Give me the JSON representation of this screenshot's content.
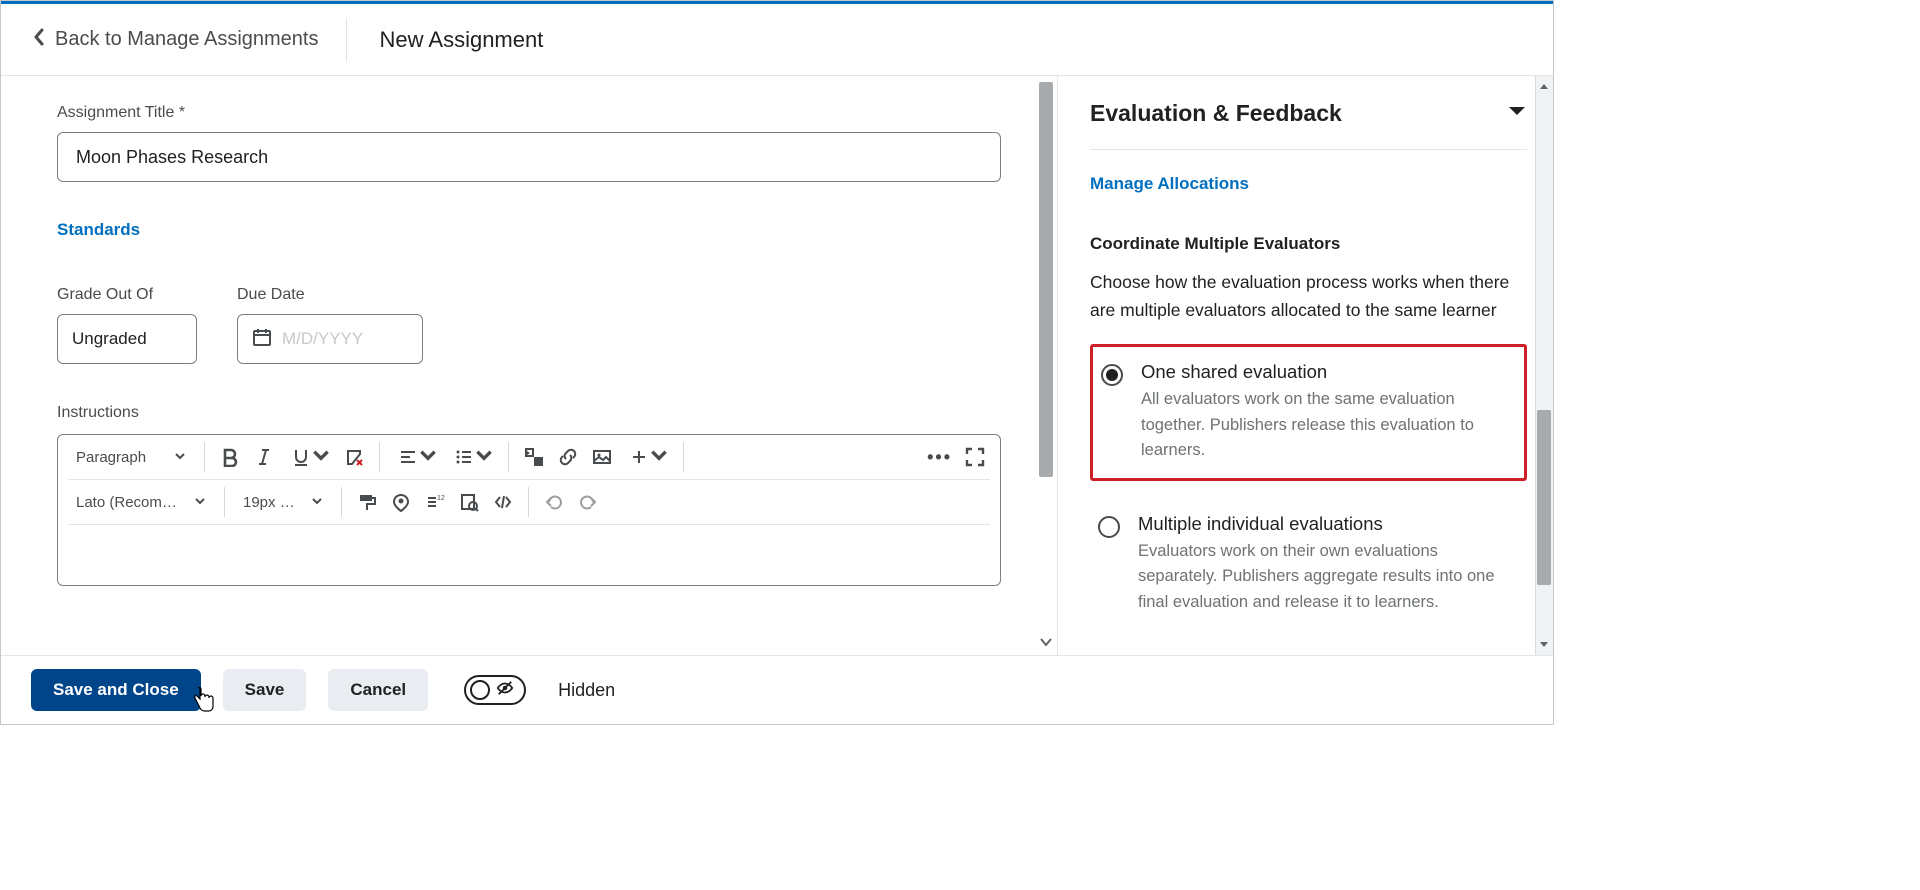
{
  "header": {
    "back_label": "Back to Manage Assignments",
    "page_title": "New Assignment"
  },
  "form": {
    "title_label": "Assignment Title *",
    "title_value": "Moon Phases Research",
    "standards_link": "Standards",
    "grade_label": "Grade Out Of",
    "grade_value": "Ungraded",
    "due_label": "Due Date",
    "due_placeholder": "M/D/YYYY",
    "instructions_label": "Instructions"
  },
  "editor": {
    "block_format": "Paragraph",
    "font_family": "Lato (Recom…",
    "font_size": "19px …"
  },
  "side": {
    "panel_title": "Evaluation & Feedback",
    "manage_link": "Manage Allocations",
    "coord_heading": "Coordinate Multiple Evaluators",
    "coord_desc": "Choose how the evaluation process works when there are multiple evaluators allocated to the same learner",
    "options": [
      {
        "label": "One shared evaluation",
        "desc": "All evaluators work on the same evaluation together. Publishers release this evaluation to learners.",
        "selected": true,
        "highlighted": true
      },
      {
        "label": "Multiple individual evaluations",
        "desc": "Evaluators work on their own evaluations separately. Publishers aggregate results into one final evaluation and release it to learners.",
        "selected": false,
        "highlighted": false
      }
    ]
  },
  "footer": {
    "save_close": "Save and Close",
    "save": "Save",
    "cancel": "Cancel",
    "visibility_label": "Hidden"
  }
}
